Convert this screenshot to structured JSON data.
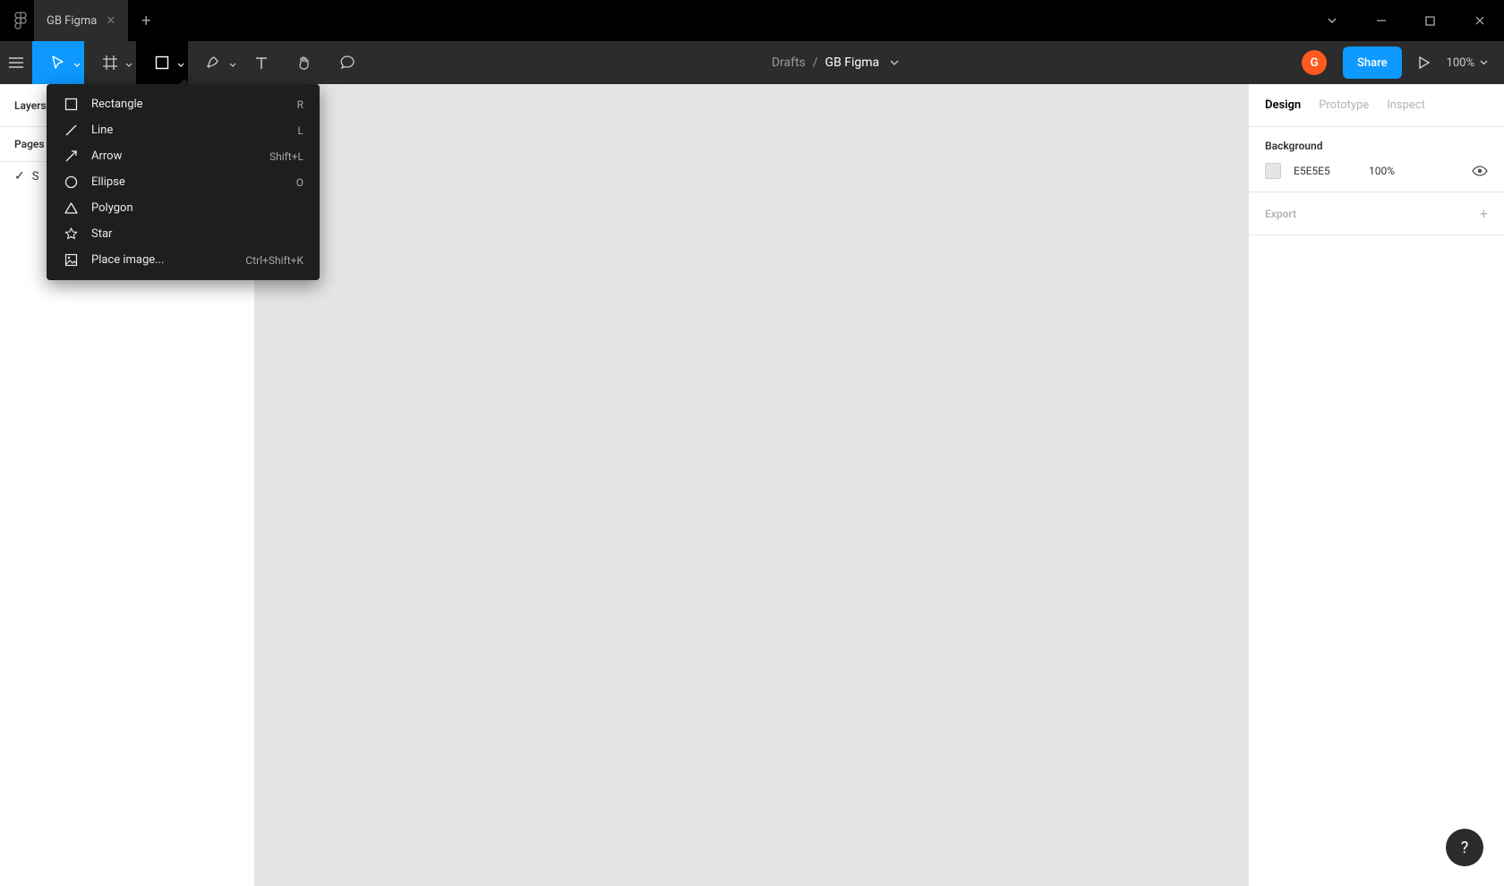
{
  "titlebar": {
    "tab_name": "GB Figma"
  },
  "breadcrumb": {
    "folder": "Drafts",
    "separator": "/",
    "file": "GB Figma"
  },
  "avatar_letter": "G",
  "share_label": "Share",
  "zoom": "100%",
  "left": {
    "tab_layers": "Layers",
    "section_pages": "Pages",
    "page1": "S"
  },
  "right": {
    "tab_design": "Design",
    "tab_prototype": "Prototype",
    "tab_inspect": "Inspect",
    "bg_title": "Background",
    "bg_hex": "E5E5E5",
    "bg_opacity": "100%",
    "export_title": "Export"
  },
  "dropdown": {
    "items": [
      {
        "label": "Rectangle",
        "shortcut": "R"
      },
      {
        "label": "Line",
        "shortcut": "L"
      },
      {
        "label": "Arrow",
        "shortcut": "Shift+L"
      },
      {
        "label": "Ellipse",
        "shortcut": "O"
      },
      {
        "label": "Polygon",
        "shortcut": ""
      },
      {
        "label": "Star",
        "shortcut": ""
      },
      {
        "label": "Place image...",
        "shortcut": "Ctrl+Shift+K"
      }
    ]
  },
  "help": "?"
}
